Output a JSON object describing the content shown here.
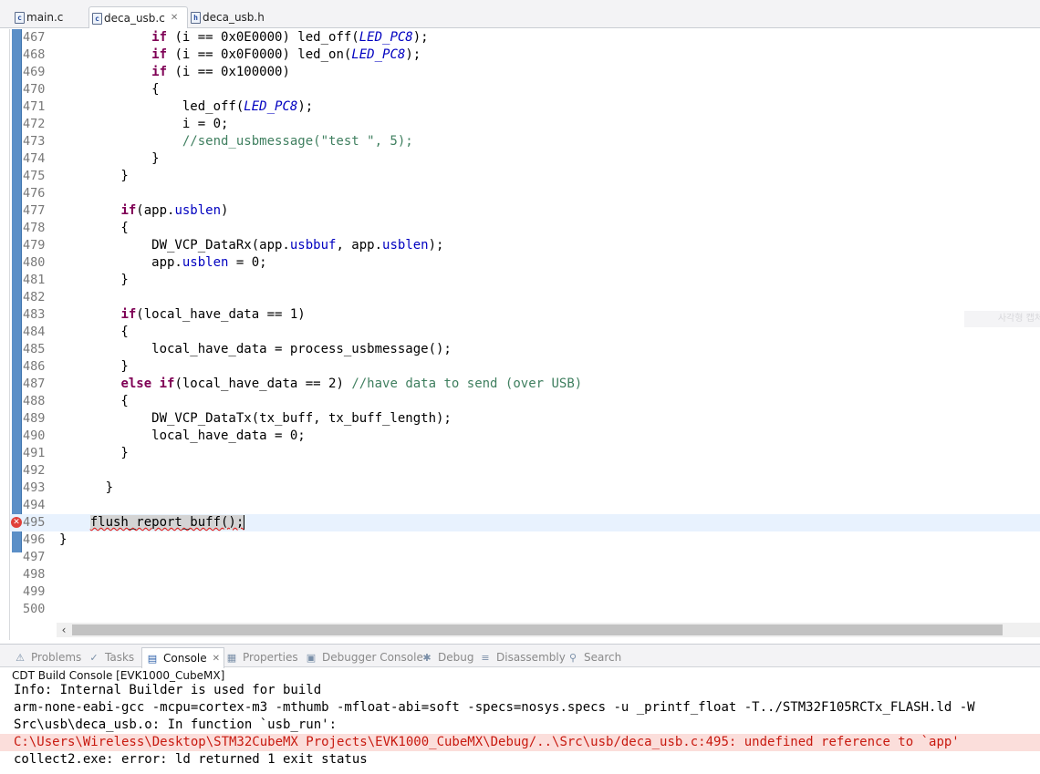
{
  "editor_tabs": [
    {
      "label": "main.c",
      "icon": "c"
    },
    {
      "label": "deca_usb.c",
      "icon": "c",
      "active": true
    },
    {
      "label": "deca_usb.h",
      "icon": "h"
    }
  ],
  "code_lines": [
    {
      "n": "467",
      "segs": [
        {
          "t": "            "
        },
        {
          "t": "if",
          "c": "kw"
        },
        {
          "t": " (i == 0x0E0000) led_off("
        },
        {
          "t": "LED_PC8",
          "c": "mac"
        },
        {
          "t": ");"
        }
      ]
    },
    {
      "n": "468",
      "segs": [
        {
          "t": "            "
        },
        {
          "t": "if",
          "c": "kw"
        },
        {
          "t": " (i == 0x0F0000) led_on("
        },
        {
          "t": "LED_PC8",
          "c": "mac"
        },
        {
          "t": ");"
        }
      ]
    },
    {
      "n": "469",
      "segs": [
        {
          "t": "            "
        },
        {
          "t": "if",
          "c": "kw"
        },
        {
          "t": " (i == 0x100000)"
        }
      ]
    },
    {
      "n": "470",
      "segs": [
        {
          "t": "            {"
        }
      ]
    },
    {
      "n": "471",
      "segs": [
        {
          "t": "                led_off("
        },
        {
          "t": "LED_PC8",
          "c": "mac"
        },
        {
          "t": ");"
        }
      ]
    },
    {
      "n": "472",
      "segs": [
        {
          "t": "                i = 0;"
        }
      ]
    },
    {
      "n": "473",
      "segs": [
        {
          "t": "                "
        },
        {
          "t": "//send_usbmessage(\"test \", 5);",
          "c": "cmt"
        }
      ]
    },
    {
      "n": "474",
      "segs": [
        {
          "t": "            }"
        }
      ]
    },
    {
      "n": "475",
      "segs": [
        {
          "t": "        }"
        }
      ]
    },
    {
      "n": "476",
      "segs": []
    },
    {
      "n": "477",
      "segs": [
        {
          "t": "        "
        },
        {
          "t": "if",
          "c": "kw"
        },
        {
          "t": "(app."
        },
        {
          "t": "usblen",
          "c": "fld"
        },
        {
          "t": ")"
        }
      ]
    },
    {
      "n": "478",
      "segs": [
        {
          "t": "        {"
        }
      ]
    },
    {
      "n": "479",
      "segs": [
        {
          "t": "            DW_VCP_DataRx(app."
        },
        {
          "t": "usbbuf",
          "c": "fld"
        },
        {
          "t": ", app."
        },
        {
          "t": "usblen",
          "c": "fld"
        },
        {
          "t": ");"
        }
      ]
    },
    {
      "n": "480",
      "segs": [
        {
          "t": "            app."
        },
        {
          "t": "usblen",
          "c": "fld"
        },
        {
          "t": " = 0;"
        }
      ]
    },
    {
      "n": "481",
      "segs": [
        {
          "t": "        }"
        }
      ]
    },
    {
      "n": "482",
      "segs": []
    },
    {
      "n": "483",
      "segs": [
        {
          "t": "        "
        },
        {
          "t": "if",
          "c": "kw"
        },
        {
          "t": "(local_have_data == 1)"
        }
      ]
    },
    {
      "n": "484",
      "segs": [
        {
          "t": "        {"
        }
      ]
    },
    {
      "n": "485",
      "segs": [
        {
          "t": "            local_have_data = process_usbmessage();"
        }
      ]
    },
    {
      "n": "486",
      "segs": [
        {
          "t": "        }"
        }
      ]
    },
    {
      "n": "487",
      "segs": [
        {
          "t": "        "
        },
        {
          "t": "else if",
          "c": "kw"
        },
        {
          "t": "(local_have_data == 2) "
        },
        {
          "t": "//have data to send (over USB)",
          "c": "cmt"
        }
      ]
    },
    {
      "n": "488",
      "segs": [
        {
          "t": "        {"
        }
      ]
    },
    {
      "n": "489",
      "segs": [
        {
          "t": "            DW_VCP_DataTx(tx_buff, tx_buff_length);"
        }
      ]
    },
    {
      "n": "490",
      "segs": [
        {
          "t": "            local_have_data = 0;"
        }
      ]
    },
    {
      "n": "491",
      "segs": [
        {
          "t": "        }"
        }
      ]
    },
    {
      "n": "492",
      "segs": []
    },
    {
      "n": "493",
      "segs": [
        {
          "t": "      }"
        }
      ]
    },
    {
      "n": "494",
      "segs": []
    },
    {
      "n": "495",
      "current": true,
      "error": true,
      "segs": [
        {
          "t": "    "
        },
        {
          "t": "flush_report_buff();",
          "c": "err-underline"
        }
      ]
    },
    {
      "n": "496",
      "segs": [
        {
          "t": "}"
        }
      ]
    },
    {
      "n": "497",
      "segs": []
    },
    {
      "n": "498",
      "segs": []
    },
    {
      "n": "499",
      "segs": []
    },
    {
      "n": "500",
      "segs": []
    }
  ],
  "ghost_text": "사각형 캡처",
  "panel_tabs": [
    {
      "label": "Problems",
      "icon": "problems-icon",
      "glyph": "⚠"
    },
    {
      "label": "Tasks",
      "icon": "tasks-icon",
      "glyph": "✓"
    },
    {
      "label": "Console",
      "icon": "console-icon",
      "glyph": "▤",
      "active": true
    },
    {
      "label": "Properties",
      "icon": "properties-icon",
      "glyph": "▦"
    },
    {
      "label": "Debugger Console",
      "icon": "debugger-console-icon",
      "glyph": "▣"
    },
    {
      "label": "Debug",
      "icon": "debug-icon",
      "glyph": "✱"
    },
    {
      "label": "Disassembly",
      "icon": "disassembly-icon",
      "glyph": "≡"
    },
    {
      "label": "Search",
      "icon": "search-icon",
      "glyph": "⚲"
    }
  ],
  "console": {
    "title": "CDT Build Console [EVK1000_CubeMX]",
    "lines": [
      {
        "text": "Info: Internal Builder is used for build"
      },
      {
        "text": "arm-none-eabi-gcc -mcpu=cortex-m3 -mthumb -mfloat-abi=soft -specs=nosys.specs -u _printf_float -T../STM32F105RCTx_FLASH.ld -W"
      },
      {
        "text": "Src\\usb\\deca_usb.o: In function `usb_run':"
      },
      {
        "text": "C:\\Users\\Wireless\\Desktop\\STM32CubeMX Projects\\EVK1000_CubeMX\\Debug/..\\Src\\usb/deca_usb.c:495: undefined reference to `app'",
        "error": true
      },
      {
        "text": "collect2.exe: error: ld returned 1 exit status"
      }
    ]
  },
  "colors": {
    "keyword": "#7f0055",
    "macro": "#0000c0",
    "comment": "#3f7f5f",
    "error_bg": "#fbdedb",
    "error_text": "#c8190f",
    "current_line": "#e8f2fe"
  }
}
